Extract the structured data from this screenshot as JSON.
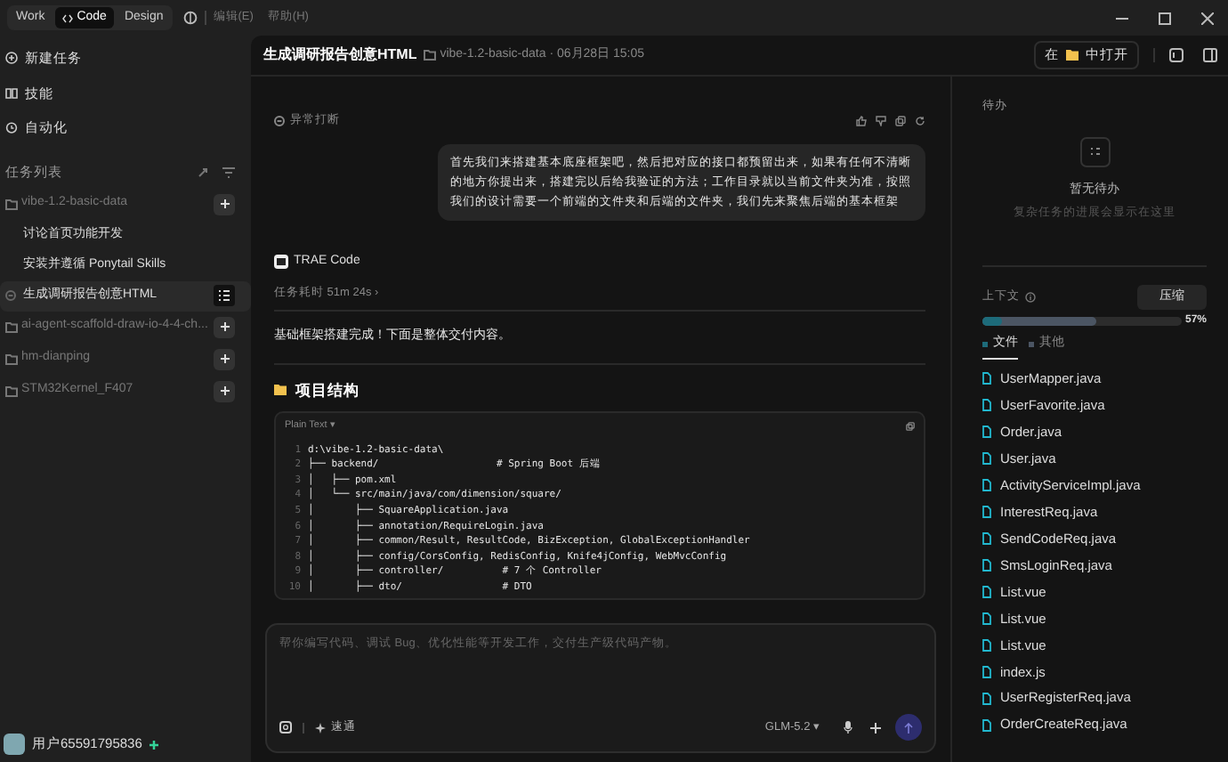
{
  "top_bar": {
    "modes": [
      {
        "label": "Work",
        "selected": false
      },
      {
        "label": "Code",
        "selected": true
      },
      {
        "label": "Design",
        "selected": false
      }
    ],
    "menus": [
      "编辑(E)",
      "帮助(H)"
    ]
  },
  "sidebar": {
    "nav": [
      {
        "label": "新建任务",
        "kind": "new"
      },
      {
        "label": "技能",
        "kind": "skills"
      },
      {
        "label": "自动化",
        "kind": "auto"
      }
    ],
    "section_title": "任务列表",
    "projects": [
      {
        "label": "vibe-1.2-basic-data",
        "children": [
          {
            "label": "讨论首页功能开发",
            "selected": false
          },
          {
            "label": "安装并遵循 Ponytail Skills",
            "selected": false
          },
          {
            "label": "生成调研报告创意HTML",
            "selected": true
          }
        ]
      },
      {
        "label": "ai-agent-scaffold-draw-io-4-4-ch..."
      },
      {
        "label": "hm-dianping"
      },
      {
        "label": "STM32Kernel_F407"
      }
    ],
    "user": {
      "name": "用户65591795836"
    }
  },
  "header": {
    "title": "生成调研报告创意HTML",
    "meta": "vibe-1.2-basic-data · 06月28日 15:05",
    "open_button": {
      "before": "在",
      "after": "中打开"
    }
  },
  "chat": {
    "interrupt_label": "异常打断",
    "user_message": "首先我们来搭建基本底座框架吧，然后把对应的接口都预留出来，如果有任何不清晰的地方你提出来，搭建完以后给我验证的方法；工作目录就以当前文件夹为准，按照我们的设计需要一个前端的文件夹和后端的文件夹，我们先来聚焦后端的基本框架",
    "agent_name": "TRAE Code",
    "duration": "任务耗时 51m 24s ›",
    "reply": "基础框架搭建完成！下面是整体交付内容。",
    "heading": "项目结构",
    "code": {
      "language": "Plain Text ▾",
      "lines": [
        {
          "number": "1",
          "text": "d:\\vibe-1.2-basic-data\\"
        },
        {
          "number": "2",
          "text": "├── backend/                    # Spring Boot 后端"
        },
        {
          "number": "3",
          "text": "│   ├── pom.xml"
        },
        {
          "number": "4",
          "text": "│   └── src/main/java/com/dimension/square/"
        },
        {
          "number": "5",
          "text": "│       ├── SquareApplication.java"
        },
        {
          "number": "6",
          "text": "│       ├── annotation/RequireLogin.java"
        },
        {
          "number": "7",
          "text": "│       ├── common/Result, ResultCode, BizException, GlobalExceptionHandler"
        },
        {
          "number": "8",
          "text": "│       ├── config/CorsConfig, RedisConfig, Knife4jConfig, WebMvcConfig"
        },
        {
          "number": "9",
          "text": "│       ├── controller/          # 7 个 Controller"
        },
        {
          "number": "10",
          "text": "│       ├── dto/                 # DTO"
        }
      ]
    }
  },
  "composer": {
    "placeholder": "帮你编写代码、调试 Bug、优化性能等开发工作，交付生产级代码产物。",
    "mode": "速通",
    "model": "GLM-5.2 ▾"
  },
  "todo": {
    "title": "待办",
    "empty_title": "暂无待办",
    "empty_hint": "复杂任务的进展会显示在这里"
  },
  "context": {
    "title": "上下文",
    "compress_button": "压缩",
    "percent": "57%",
    "usage": {
      "level": 0.57
    },
    "files_usage": {
      "level": 0.1
    },
    "segments": [
      {
        "label": "文件",
        "selected": true,
        "color": "#1d6b7a"
      },
      {
        "label": "其他",
        "selected": false,
        "color": "#4b5563"
      }
    ],
    "files": [
      "UserMapper.java",
      "UserFavorite.java",
      "Order.java",
      "User.java",
      "ActivityServiceImpl.java",
      "InterestReq.java",
      "SendCodeReq.java",
      "SmsLoginReq.java",
      "List.vue",
      "List.vue",
      "List.vue",
      "index.js",
      "UserRegisterReq.java",
      "OrderCreateReq.java"
    ]
  }
}
